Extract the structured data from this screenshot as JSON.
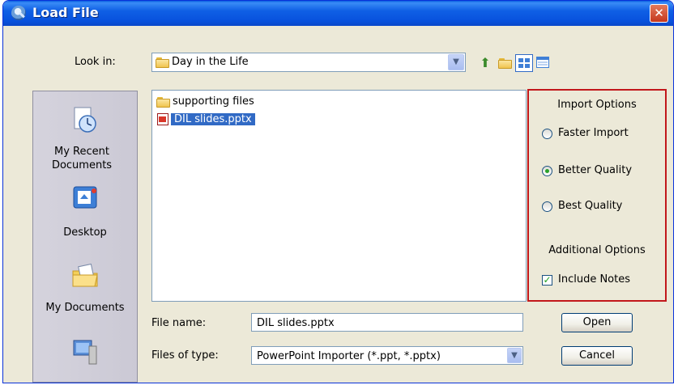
{
  "window": {
    "title": "Load File",
    "close_icon": "close-icon"
  },
  "lookin": {
    "label": "Look in:",
    "value": "Day in the Life"
  },
  "toolbar": {
    "icons": [
      "up-folder-icon",
      "new-folder-icon",
      "list-view-icon",
      "details-view-icon"
    ]
  },
  "places": [
    {
      "label": "My Recent Documents",
      "icon": "recent-documents-icon"
    },
    {
      "label": "Desktop",
      "icon": "desktop-icon"
    },
    {
      "label": "My Documents",
      "icon": "my-documents-icon"
    },
    {
      "label": "",
      "icon": "my-computer-icon"
    }
  ],
  "files": [
    {
      "name": "supporting files",
      "type": "folder",
      "selected": false
    },
    {
      "name": "DIL slides.pptx",
      "type": "pptx",
      "selected": true
    }
  ],
  "import_options": {
    "heading": "Import Options",
    "radios": [
      {
        "label": "Faster Import",
        "checked": false
      },
      {
        "label": "Better Quality",
        "checked": true
      },
      {
        "label": "Best Quality",
        "checked": false
      }
    ],
    "additional_heading": "Additional Options",
    "include_notes": {
      "label": "Include Notes",
      "checked": true
    }
  },
  "filename": {
    "label": "File name:",
    "value": "DIL slides.pptx"
  },
  "filetype": {
    "label": "Files of type:",
    "value": "PowerPoint Importer (*.ppt, *.pptx)"
  },
  "buttons": {
    "open": "Open",
    "cancel": "Cancel"
  },
  "colors": {
    "highlight_border": "#c2171b",
    "selection": "#316ac5",
    "titlebar": "#0852dd"
  }
}
